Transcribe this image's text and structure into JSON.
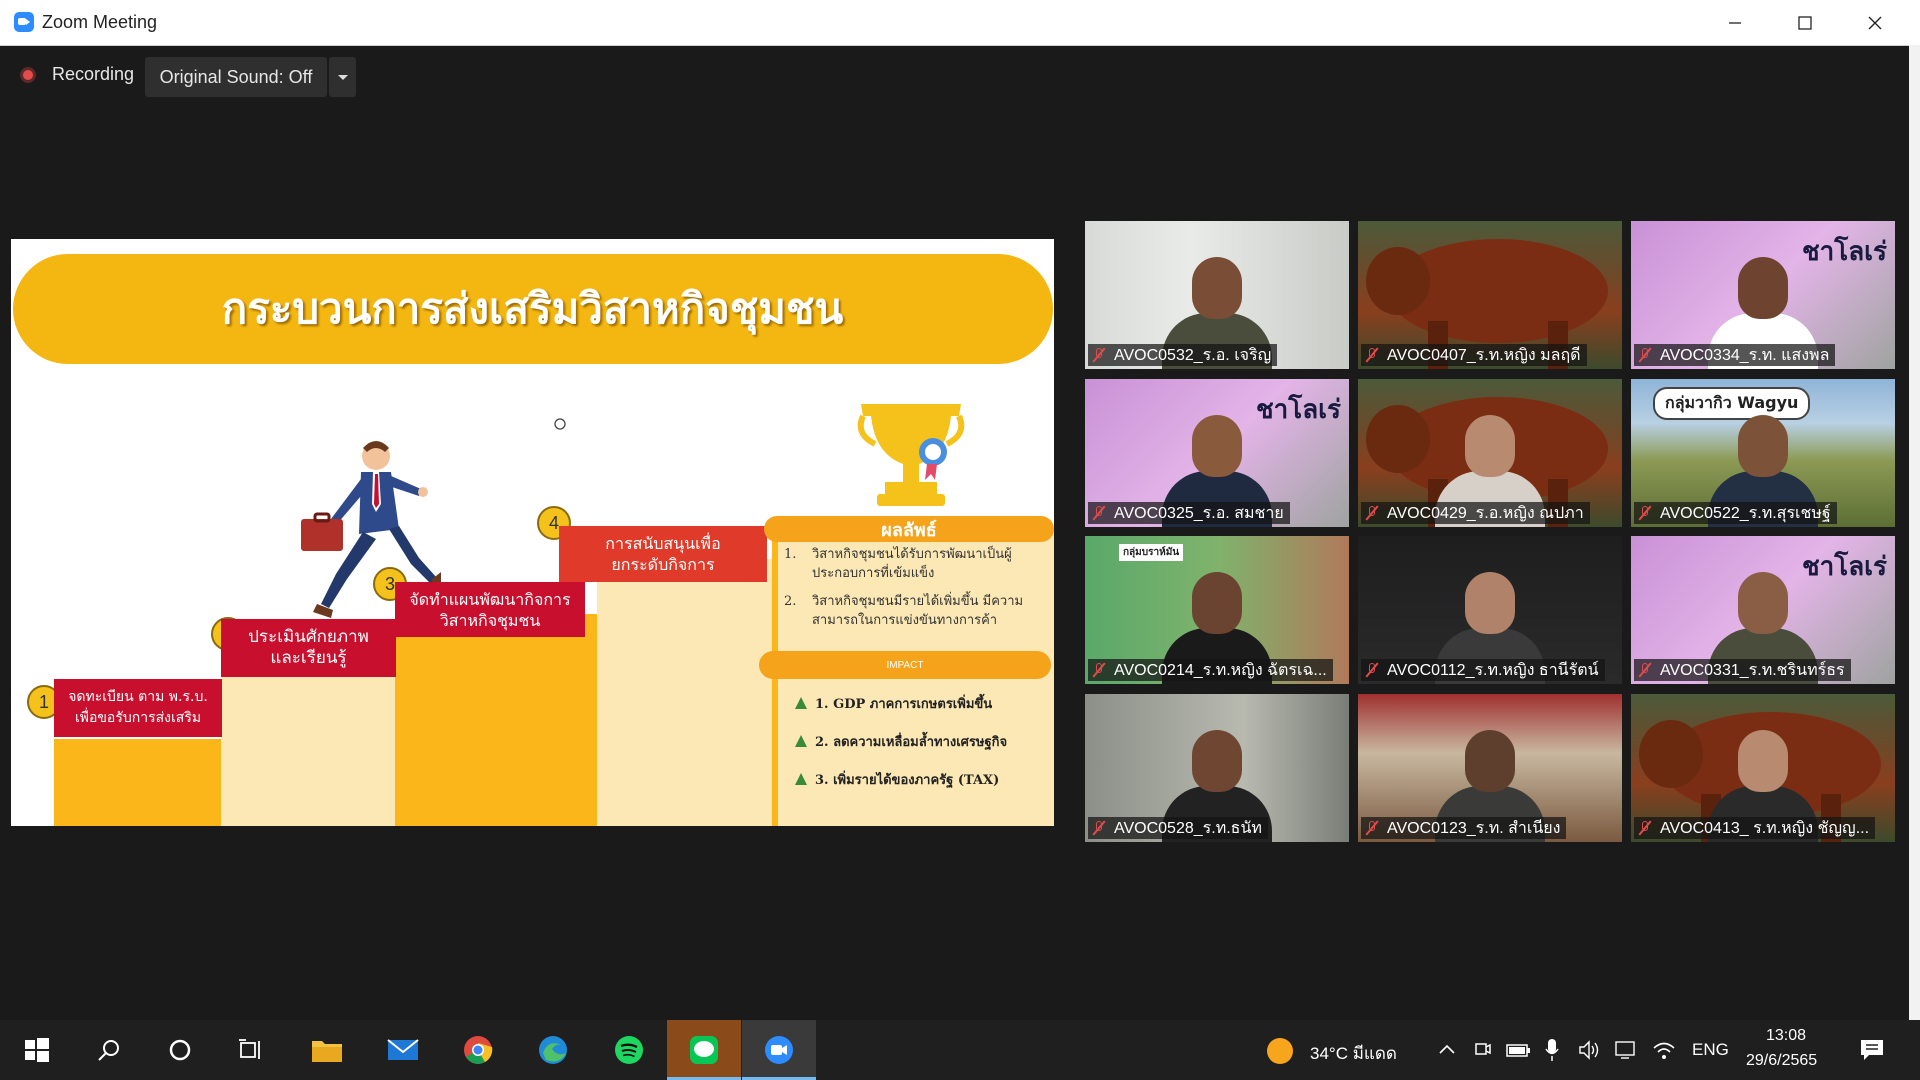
{
  "window": {
    "title": "Zoom Meeting"
  },
  "toolbar": {
    "recording_label": "Recording",
    "sound_label": "Original Sound: Off"
  },
  "slide": {
    "title": "กระบวนการส่งเสริมวิสาหกิจชุมชน",
    "steps": [
      {
        "num": "1",
        "label": "จดทะเบียน ตาม พ.ร.บ.\nเพื่อขอรับการส่งเสริม"
      },
      {
        "num": "2",
        "label": "ประเมินศักยภาพ\nและเรียนรู้"
      },
      {
        "num": "3",
        "label": "จัดทำแผนพัฒนากิจการ\nวิสาหกิจชุมชน"
      },
      {
        "num": "4",
        "label": "การสนับสนุนเพื่อ\nยกระดับกิจการ"
      }
    ],
    "results_title": "ผลลัพธ์",
    "results": [
      {
        "num": "1.",
        "text": "วิสาหกิจชุมชนได้รับการพัฒนาเป็นผู้ประกอบการที่เข้มแข็ง"
      },
      {
        "num": "2.",
        "text": "วิสาหกิจชุมชนมีรายได้เพิ่มขึ้น มีความสามารถในการแข่งขันทางการค้า"
      }
    ],
    "impact_title": "IMPACT",
    "impacts": [
      "1. GDP ภาคการเกษตรเพิ่มขึ้น",
      "2. ลดความเหลื่อมล้ำทางเศรษฐกิจ",
      "3. เพิ่มรายได้ของภาครัฐ (TAX)"
    ]
  },
  "participants": [
    {
      "name": "AVOC0532_ร.อ. เจริญ",
      "bg": "room",
      "overlay": ""
    },
    {
      "name": "AVOC0407_ร.ท.หญิง มลฤดี",
      "bg": "cow",
      "overlay": ""
    },
    {
      "name": "AVOC0334_ร.ท. แสงพล",
      "bg": "pink",
      "overlay": "ชาโลเร่"
    },
    {
      "name": "AVOC0325_ร.อ. สมชาย",
      "bg": "pink",
      "overlay": "ชาโลเร่"
    },
    {
      "name": "AVOC0429_ร.อ.หญิง ณปภา",
      "bg": "cow",
      "overlay": ""
    },
    {
      "name": "AVOC0522_ร.ท.สุรเชษฐ์",
      "bg": "field",
      "overlay": "กลุ่มวากิว Wagyu"
    },
    {
      "name": "AVOC0214_ร.ท.หญิง ฉัตรเฉ...",
      "bg": "farm",
      "overlay": "กลุ่มบราห์มัน"
    },
    {
      "name": "AVOC0112_ร.ท.หญิง ธานีรัตน์",
      "bg": "dark",
      "overlay": ""
    },
    {
      "name": "AVOC0331_ร.ท.ชรินทร์ธร",
      "bg": "pink",
      "overlay": "ชาโลเร่"
    },
    {
      "name": "AVOC0528_ร.ท.ธนัท",
      "bg": "office",
      "overlay": ""
    },
    {
      "name": "AVOC0123_ร.ท. สำเนียง",
      "bg": "wall",
      "overlay": ""
    },
    {
      "name": "AVOC0413_ ร.ท.หญิง ชัญญ...",
      "bg": "cow",
      "overlay": ""
    }
  ],
  "taskbar": {
    "weather": "34°C  มีแดด",
    "language": "ENG",
    "time": "13:08",
    "date": "29/6/2565"
  },
  "colors": {
    "slide_yellow": "#f4b712",
    "step_red": "#c8102e",
    "zoom_blue": "#2d8cff",
    "mic_red": "#e34b4b"
  }
}
